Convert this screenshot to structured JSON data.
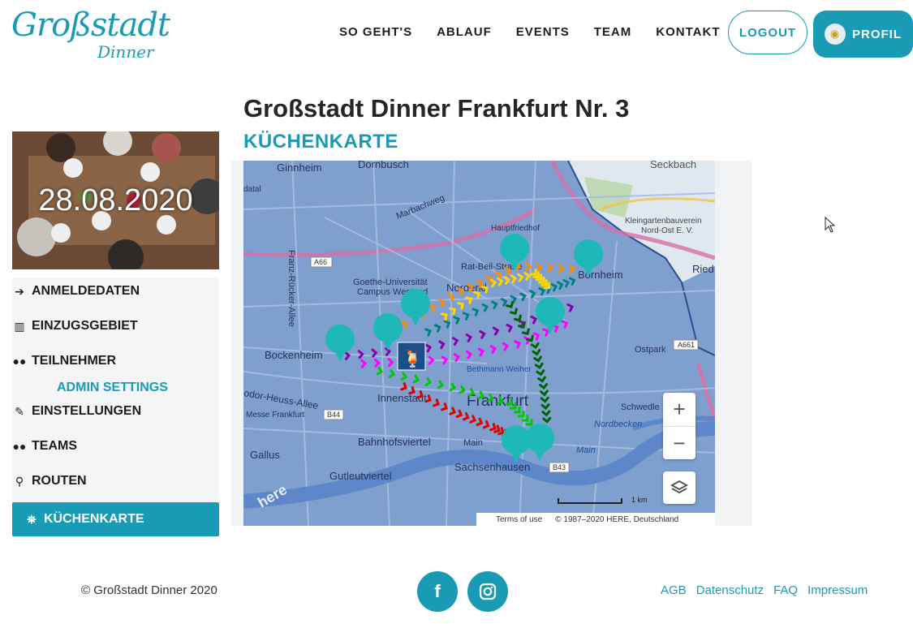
{
  "logo": {
    "line1": "Großstadt",
    "line2": "Dinner"
  },
  "nav": {
    "items": [
      "SO GEHT'S",
      "ABLAUF",
      "EVENTS",
      "TEAM",
      "KONTAKT"
    ]
  },
  "header": {
    "logout_label": "LOGOUT",
    "profil_label": "PROFIL"
  },
  "page": {
    "title": "Großstadt Dinner Frankfurt Nr. 3",
    "subtitle": "KÜCHENKARTE"
  },
  "event": {
    "date": "28.08.2020"
  },
  "sidebar": {
    "items": [
      {
        "label": "ANMELDEDATEN",
        "icon": "sign-in-icon"
      },
      {
        "label": "EINZUGSGEBIET",
        "icon": "map-icon"
      },
      {
        "label": "TEILNEHMER",
        "icon": "users-icon"
      },
      {
        "label": "EINSTELLUNGEN",
        "icon": "wrench-icon"
      },
      {
        "label": "TEAMS",
        "icon": "users-icon"
      },
      {
        "label": "ROUTEN",
        "icon": "route-icon"
      },
      {
        "label": "KÜCHENKARTE",
        "icon": "map-marked-icon"
      }
    ],
    "admin_label": "ADMIN SETTINGS",
    "active": "KÜCHENKARTE"
  },
  "map": {
    "labels": {
      "ginnheim": "Ginnheim",
      "dornbusch": "Dornbusch",
      "seckbach": "Seckbach",
      "marbachweg": "Marbachweg",
      "hauptfriedhof": "Hauptfriedhof",
      "kleingarten1": "Kleingartenbauverein",
      "kleingarten2": "Nord-Ost E. V.",
      "ratbeil": "Rat-Beil-Straße",
      "bornheim": "Bornheim",
      "ried": "Ried",
      "goethe1": "Goethe-Universität",
      "goethe2": "Campus Westend",
      "nordend": "Nordend",
      "franz": "Franz-Rücker-Allee",
      "bockenheim": "Bockenheim",
      "ostpark": "Ostpark",
      "bethmann": "Bethmann Weiher",
      "frankfurt": "Frankfurt",
      "theodor": "odor-Heuss-Allee",
      "innenstadt": "Innenstadt",
      "messe": "Messe Frankfurt",
      "bahnhof": "Bahnhofsviertel",
      "schwedler": "Schwedle",
      "nordbecken": "Nordbecken",
      "gallus": "Gallus",
      "main": "Main",
      "sachsenhausen": "Sachsenhausen",
      "gutleut": "Gutleutviertel",
      "datal": "datal",
      "a66": "A66",
      "a661": "A661",
      "b44": "B44",
      "b43": "B43",
      "scale": "1 km"
    },
    "zoom_in": "+",
    "zoom_out": "−",
    "terms": "Terms of use",
    "copyright": "© 1987–2020 HERE, Deutschland",
    "provider": "here"
  },
  "footer": {
    "copyright": "© Großstadt Dinner 2020",
    "facebook": "f",
    "links": [
      "AGB",
      "Datenschutz",
      "FAQ",
      "Impressum"
    ]
  },
  "colors": {
    "accent": "#1a9bb5",
    "marker": "#1fb8b8"
  }
}
